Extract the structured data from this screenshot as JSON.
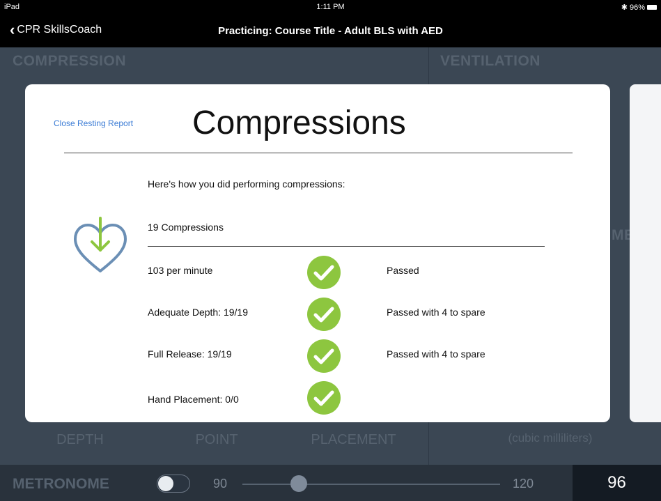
{
  "status_bar": {
    "device": "iPad",
    "time": "1:11 PM",
    "battery": "96%"
  },
  "nav": {
    "back_label": "CPR SkillsCoach",
    "title": "Practicing: Course Title - Adult BLS with AED"
  },
  "background": {
    "compression_header": "COMPRESSION",
    "ventilation_header": "VENTILATION",
    "compression_depth_label": "DEPTH",
    "release_point_label": "POINT",
    "hand_placement_label": "PLACEMENT",
    "ventilation_volume_unit": "(cubic milliliters)",
    "ventilation_volume_partial": "ME"
  },
  "metronome": {
    "label": "METRONOME",
    "min": "90",
    "max": "120",
    "value": "96",
    "enabled": false,
    "slider_fraction": 0.2
  },
  "report": {
    "close_label": "Close Resting Report",
    "heading": "Compressions",
    "intro": "Here's how you did performing compressions:",
    "count_label": "19 Compressions",
    "icon": "heart-download-icon",
    "rows": [
      {
        "label": "103 per minute",
        "status": "Passed",
        "icon": "check-circle-icon"
      },
      {
        "label": "Adequate Depth: 19/19",
        "status": "Passed with 4 to spare",
        "icon": "check-circle-icon"
      },
      {
        "label": "Full Release: 19/19",
        "status": "Passed with 4 to spare",
        "icon": "check-circle-icon"
      },
      {
        "label": "Hand Placement: 0/0",
        "status": "",
        "icon": "check-circle-icon"
      }
    ]
  },
  "colors": {
    "check_green": "#8dc63f",
    "link_blue": "#3a7bd5",
    "heart_blue": "#6b8fb5",
    "arrow_green": "#8dc63f"
  }
}
